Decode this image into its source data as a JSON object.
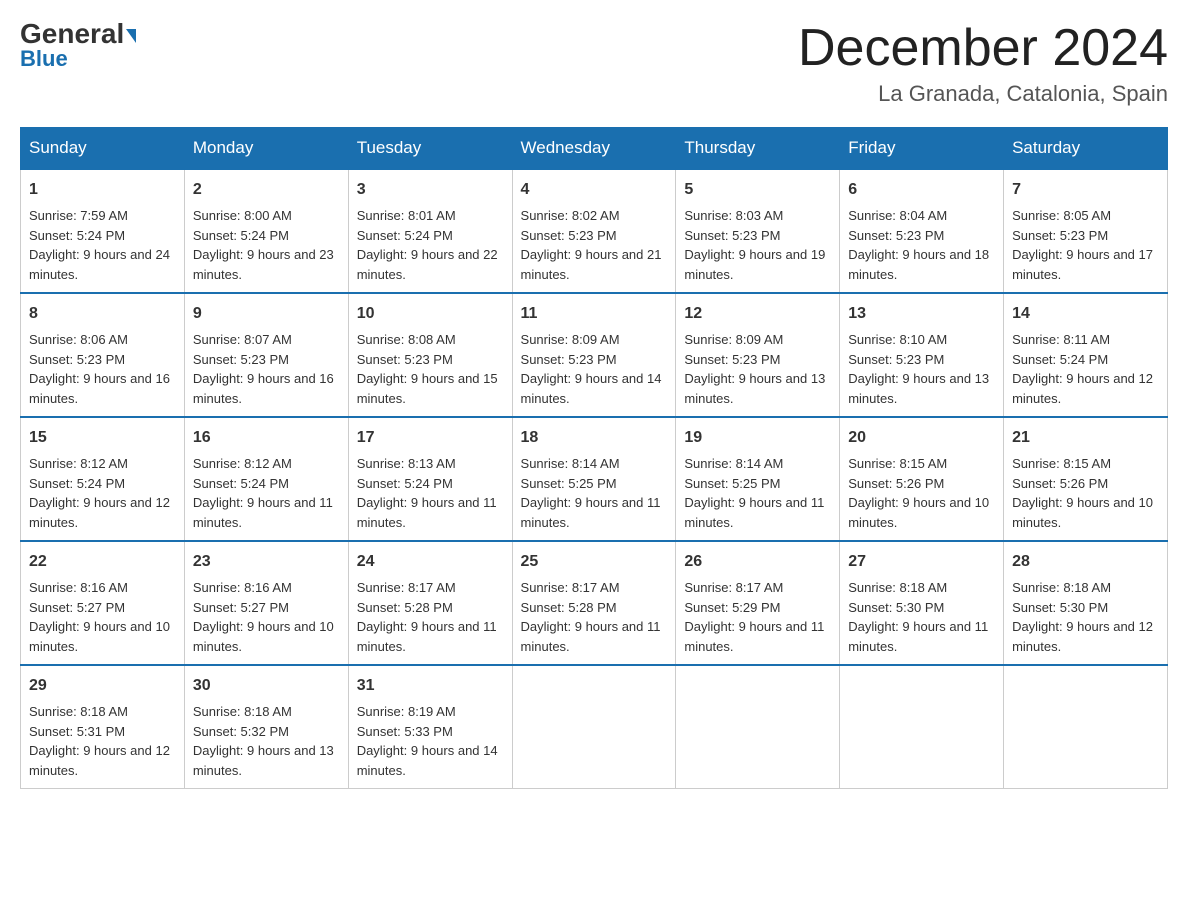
{
  "header": {
    "logo_line1": "General",
    "logo_line2": "Blue",
    "month_year": "December 2024",
    "location": "La Granada, Catalonia, Spain"
  },
  "days_of_week": [
    "Sunday",
    "Monday",
    "Tuesday",
    "Wednesday",
    "Thursday",
    "Friday",
    "Saturday"
  ],
  "weeks": [
    [
      {
        "day": "1",
        "sunrise": "7:59 AM",
        "sunset": "5:24 PM",
        "daylight": "9 hours and 24 minutes."
      },
      {
        "day": "2",
        "sunrise": "8:00 AM",
        "sunset": "5:24 PM",
        "daylight": "9 hours and 23 minutes."
      },
      {
        "day": "3",
        "sunrise": "8:01 AM",
        "sunset": "5:24 PM",
        "daylight": "9 hours and 22 minutes."
      },
      {
        "day": "4",
        "sunrise": "8:02 AM",
        "sunset": "5:23 PM",
        "daylight": "9 hours and 21 minutes."
      },
      {
        "day": "5",
        "sunrise": "8:03 AM",
        "sunset": "5:23 PM",
        "daylight": "9 hours and 19 minutes."
      },
      {
        "day": "6",
        "sunrise": "8:04 AM",
        "sunset": "5:23 PM",
        "daylight": "9 hours and 18 minutes."
      },
      {
        "day": "7",
        "sunrise": "8:05 AM",
        "sunset": "5:23 PM",
        "daylight": "9 hours and 17 minutes."
      }
    ],
    [
      {
        "day": "8",
        "sunrise": "8:06 AM",
        "sunset": "5:23 PM",
        "daylight": "9 hours and 16 minutes."
      },
      {
        "day": "9",
        "sunrise": "8:07 AM",
        "sunset": "5:23 PM",
        "daylight": "9 hours and 16 minutes."
      },
      {
        "day": "10",
        "sunrise": "8:08 AM",
        "sunset": "5:23 PM",
        "daylight": "9 hours and 15 minutes."
      },
      {
        "day": "11",
        "sunrise": "8:09 AM",
        "sunset": "5:23 PM",
        "daylight": "9 hours and 14 minutes."
      },
      {
        "day": "12",
        "sunrise": "8:09 AM",
        "sunset": "5:23 PM",
        "daylight": "9 hours and 13 minutes."
      },
      {
        "day": "13",
        "sunrise": "8:10 AM",
        "sunset": "5:23 PM",
        "daylight": "9 hours and 13 minutes."
      },
      {
        "day": "14",
        "sunrise": "8:11 AM",
        "sunset": "5:24 PM",
        "daylight": "9 hours and 12 minutes."
      }
    ],
    [
      {
        "day": "15",
        "sunrise": "8:12 AM",
        "sunset": "5:24 PM",
        "daylight": "9 hours and 12 minutes."
      },
      {
        "day": "16",
        "sunrise": "8:12 AM",
        "sunset": "5:24 PM",
        "daylight": "9 hours and 11 minutes."
      },
      {
        "day": "17",
        "sunrise": "8:13 AM",
        "sunset": "5:24 PM",
        "daylight": "9 hours and 11 minutes."
      },
      {
        "day": "18",
        "sunrise": "8:14 AM",
        "sunset": "5:25 PM",
        "daylight": "9 hours and 11 minutes."
      },
      {
        "day": "19",
        "sunrise": "8:14 AM",
        "sunset": "5:25 PM",
        "daylight": "9 hours and 11 minutes."
      },
      {
        "day": "20",
        "sunrise": "8:15 AM",
        "sunset": "5:26 PM",
        "daylight": "9 hours and 10 minutes."
      },
      {
        "day": "21",
        "sunrise": "8:15 AM",
        "sunset": "5:26 PM",
        "daylight": "9 hours and 10 minutes."
      }
    ],
    [
      {
        "day": "22",
        "sunrise": "8:16 AM",
        "sunset": "5:27 PM",
        "daylight": "9 hours and 10 minutes."
      },
      {
        "day": "23",
        "sunrise": "8:16 AM",
        "sunset": "5:27 PM",
        "daylight": "9 hours and 10 minutes."
      },
      {
        "day": "24",
        "sunrise": "8:17 AM",
        "sunset": "5:28 PM",
        "daylight": "9 hours and 11 minutes."
      },
      {
        "day": "25",
        "sunrise": "8:17 AM",
        "sunset": "5:28 PM",
        "daylight": "9 hours and 11 minutes."
      },
      {
        "day": "26",
        "sunrise": "8:17 AM",
        "sunset": "5:29 PM",
        "daylight": "9 hours and 11 minutes."
      },
      {
        "day": "27",
        "sunrise": "8:18 AM",
        "sunset": "5:30 PM",
        "daylight": "9 hours and 11 minutes."
      },
      {
        "day": "28",
        "sunrise": "8:18 AM",
        "sunset": "5:30 PM",
        "daylight": "9 hours and 12 minutes."
      }
    ],
    [
      {
        "day": "29",
        "sunrise": "8:18 AM",
        "sunset": "5:31 PM",
        "daylight": "9 hours and 12 minutes."
      },
      {
        "day": "30",
        "sunrise": "8:18 AM",
        "sunset": "5:32 PM",
        "daylight": "9 hours and 13 minutes."
      },
      {
        "day": "31",
        "sunrise": "8:19 AM",
        "sunset": "5:33 PM",
        "daylight": "9 hours and 14 minutes."
      },
      null,
      null,
      null,
      null
    ]
  ]
}
